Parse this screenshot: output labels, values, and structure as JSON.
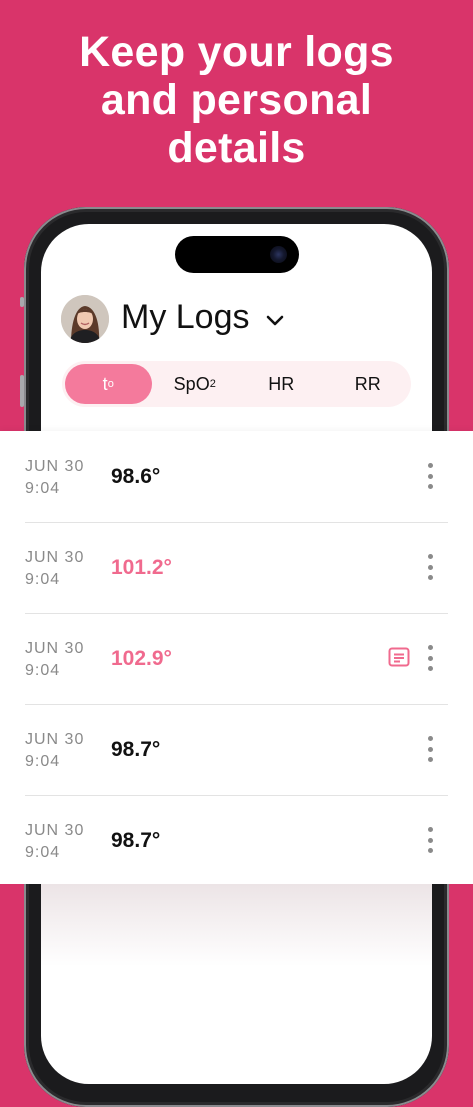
{
  "headline": {
    "line1": "Keep your logs",
    "line2": "and personal",
    "line3": "details"
  },
  "header": {
    "title": "My Logs",
    "dropdown_icon": "chevron-down-icon",
    "avatar_icon": "user-avatar"
  },
  "tabs": [
    {
      "label": "t",
      "sup": "o",
      "active": true
    },
    {
      "label": "SpO",
      "sub": "2",
      "active": false
    },
    {
      "label": "HR",
      "active": false
    },
    {
      "label": "RR",
      "active": false
    }
  ],
  "logs": [
    {
      "date": "JUN 30",
      "time": "9:04",
      "value": "98.6°",
      "elevated": false,
      "has_note": false
    },
    {
      "date": "JUN 30",
      "time": "9:04",
      "value": "101.2°",
      "elevated": true,
      "has_note": false
    },
    {
      "date": "JUN 30",
      "time": "9:04",
      "value": "102.9°",
      "elevated": true,
      "has_note": true
    },
    {
      "date": "JUN 30",
      "time": "9:04",
      "value": "98.7°",
      "elevated": false,
      "has_note": false
    },
    {
      "date": "JUN 30",
      "time": "9:04",
      "value": "98.7°",
      "elevated": false,
      "has_note": false
    }
  ],
  "colors": {
    "background": "#d9346a",
    "accent": "#f47a9c",
    "elevated_value": "#f06a8e",
    "tab_track": "#fdf0f2"
  }
}
